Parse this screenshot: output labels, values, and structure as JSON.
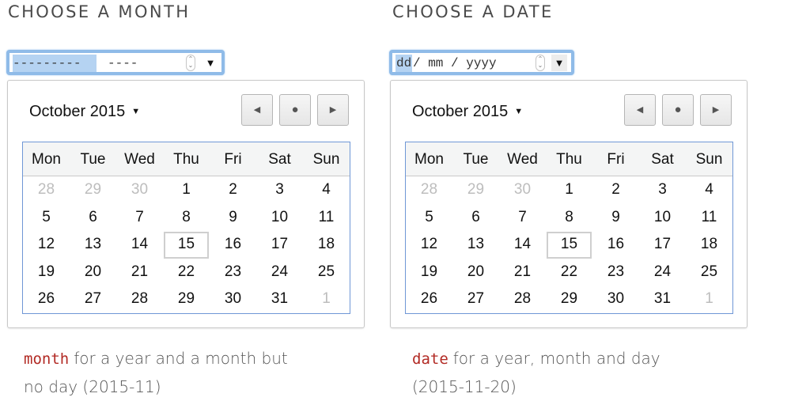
{
  "sections": [
    {
      "heading": "CHOOSE A MONTH",
      "input": {
        "segments": [
          "---------",
          "----"
        ],
        "spinner_glyph": "⌃⌄",
        "dropdown_glyph": "▼"
      },
      "calendar": {
        "month_label": "October 2015",
        "caret": "▼",
        "nav": {
          "prev": "◀",
          "today": "●",
          "next": "▶"
        },
        "weekdays": [
          "Mon",
          "Tue",
          "Wed",
          "Thu",
          "Fri",
          "Sat",
          "Sun"
        ],
        "weeks": [
          [
            "28",
            "29",
            "30",
            "1",
            "2",
            "3",
            "4"
          ],
          [
            "5",
            "6",
            "7",
            "8",
            "9",
            "10",
            "11"
          ],
          [
            "12",
            "13",
            "14",
            "15",
            "16",
            "17",
            "18"
          ],
          [
            "19",
            "20",
            "21",
            "22",
            "23",
            "24",
            "25"
          ],
          [
            "26",
            "27",
            "28",
            "29",
            "30",
            "31",
            "1"
          ]
        ],
        "today": "15"
      },
      "caption": {
        "code": "month",
        "text": "for a year and a month but no day (2015-11)"
      }
    },
    {
      "heading": "CHOOSE A DATE",
      "input": {
        "segments": [
          "dd",
          "/ mm / yyyy"
        ],
        "spinner_glyph": "⌃⌄",
        "dropdown_glyph": "▼"
      },
      "calendar": {
        "month_label": "October 2015",
        "caret": "▼",
        "nav": {
          "prev": "◀",
          "today": "●",
          "next": "▶"
        },
        "weekdays": [
          "Mon",
          "Tue",
          "Wed",
          "Thu",
          "Fri",
          "Sat",
          "Sun"
        ],
        "weeks": [
          [
            "28",
            "29",
            "30",
            "1",
            "2",
            "3",
            "4"
          ],
          [
            "5",
            "6",
            "7",
            "8",
            "9",
            "10",
            "11"
          ],
          [
            "12",
            "13",
            "14",
            "15",
            "16",
            "17",
            "18"
          ],
          [
            "19",
            "20",
            "21",
            "22",
            "23",
            "24",
            "25"
          ],
          [
            "26",
            "27",
            "28",
            "29",
            "30",
            "31",
            "1"
          ]
        ],
        "today": "15"
      },
      "caption": {
        "code": "date",
        "text": "for a year, month and day (2015-11-20)"
      }
    }
  ],
  "colors": {
    "focus_ring": "#8fbbe8",
    "selection": "#b5d3f2",
    "grid_border": "#6f97d6",
    "code_text": "#b22a24",
    "other_month_day": "#bdbdbd"
  }
}
